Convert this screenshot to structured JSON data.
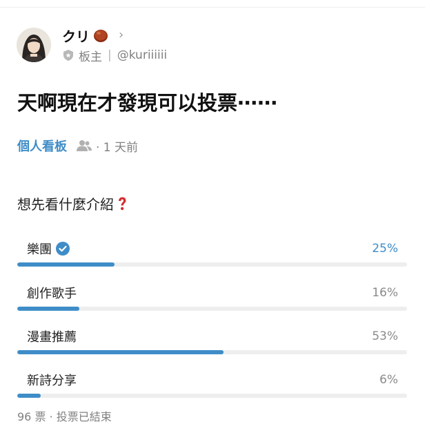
{
  "author": {
    "name": "クリ",
    "role": "板主",
    "handle": "@kuriiiiii"
  },
  "post": {
    "title": "天啊現在才發現可以投票⋯⋯",
    "board": "個人看板",
    "time": "· 1 天前"
  },
  "poll": {
    "question": "想先看什麼介紹",
    "options": [
      {
        "label": "樂團",
        "percent_text": "25%",
        "fraction": 0.25,
        "selected": true
      },
      {
        "label": "創作歌手",
        "percent_text": "16%",
        "fraction": 0.16,
        "selected": false
      },
      {
        "label": "漫畫推薦",
        "percent_text": "53%",
        "fraction": 0.53,
        "selected": false
      },
      {
        "label": "新詩分享",
        "percent_text": "6%",
        "fraction": 0.06,
        "selected": false
      }
    ],
    "footer": "96 票 · 投票已結束"
  },
  "colors": {
    "accent": "#3f8dc8",
    "track": "#eeeeee",
    "question_mark": "#d62e2e"
  },
  "icons": [
    "avatar",
    "chestnut-emoji-icon",
    "chevron-right-icon",
    "shield-icon",
    "people-icon",
    "question-mark-icon",
    "verified-check-icon"
  ]
}
